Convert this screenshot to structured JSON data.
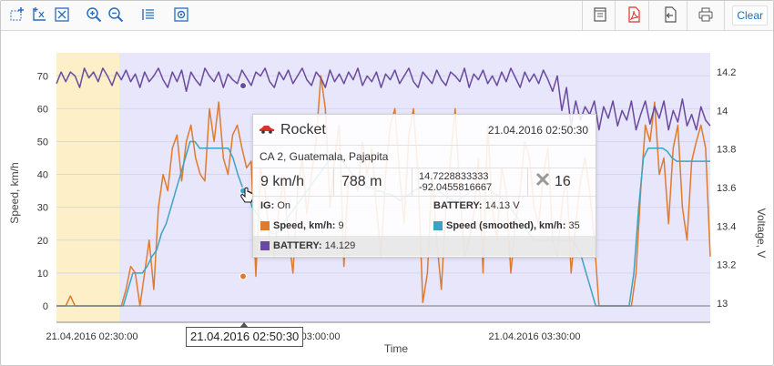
{
  "toolbar": {
    "left_icons": [
      "select-zoom-icon",
      "zoom-x-icon",
      "zoom-fit-icon",
      "zoom-in-icon",
      "zoom-out-icon",
      "legend-list-icon",
      "snapshot-icon"
    ],
    "right_icons": [
      "document-icon",
      "pdf-icon",
      "export-icon",
      "print-icon"
    ],
    "clear_label": "Clear"
  },
  "chart_data": {
    "type": "line",
    "xlabel": "Time",
    "ylabel": "Speed, km/h",
    "y2label": "Voltage, V",
    "ylim": [
      -5,
      77
    ],
    "y2lim": [
      12.9,
      14.3
    ],
    "y_ticks": [
      "0",
      "10",
      "20",
      "30",
      "40",
      "50",
      "60",
      "70"
    ],
    "y2_ticks": [
      "13",
      "13.2",
      "13.4",
      "13.6",
      "13.8",
      "14",
      "14.2"
    ],
    "x_ticks": [
      "21.04.2016 02:30:00",
      "21.04.2016 03:00:00",
      "21.04.2016 03:30:00"
    ],
    "highlight_x_label": "21.04.2016 02:50:30",
    "series": [
      {
        "name": "Speed, km/h",
        "color": "#e07b2e",
        "axis": "left",
        "values": [
          0,
          0,
          0,
          3,
          0,
          0,
          0,
          0,
          0,
          0,
          0,
          0,
          0,
          0,
          0,
          5,
          12,
          10,
          0,
          10,
          20,
          5,
          30,
          40,
          35,
          48,
          52,
          38,
          50,
          55,
          45,
          40,
          38,
          60,
          50,
          62,
          45,
          40,
          52,
          55,
          48,
          42,
          44,
          9,
          42,
          35,
          20,
          15,
          30,
          38,
          22,
          10,
          35,
          45,
          28,
          40,
          50,
          70,
          60,
          30,
          45,
          55,
          12,
          40,
          38,
          35,
          50,
          40,
          48,
          30,
          15,
          40,
          55,
          60,
          40,
          25,
          52,
          60,
          40,
          1,
          10,
          40,
          20,
          5,
          30,
          45,
          60,
          35,
          15,
          20,
          28,
          45,
          10,
          55,
          30,
          20,
          42,
          35,
          10,
          25,
          35,
          50,
          45,
          30,
          25,
          40,
          48,
          20,
          15,
          30,
          40,
          10,
          25,
          38,
          45,
          35,
          20,
          0,
          0,
          0,
          0,
          0,
          0,
          0,
          0,
          10,
          35,
          55,
          50,
          62,
          40,
          45,
          25,
          48,
          55,
          30,
          20,
          44,
          50,
          55,
          48,
          15
        ]
      },
      {
        "name": "Speed (smoothed), km/h",
        "color": "#3da3c4",
        "axis": "left",
        "values": [
          0,
          0,
          0,
          0,
          0,
          0,
          0,
          0,
          0,
          0,
          0,
          0,
          0,
          0,
          0,
          5,
          10,
          10,
          10,
          12,
          15,
          17,
          22,
          25,
          30,
          35,
          40,
          45,
          50,
          50,
          48,
          48,
          48,
          48,
          48,
          48,
          48,
          45,
          40,
          36,
          35,
          30,
          28,
          26,
          25,
          22,
          22,
          24,
          26,
          28,
          30,
          32,
          34,
          36,
          38,
          40,
          42,
          44,
          46,
          45,
          44,
          42,
          40,
          38,
          38,
          36,
          36,
          35,
          35,
          34,
          34,
          33,
          32,
          33,
          34,
          35,
          36,
          37,
          37,
          36,
          35,
          34,
          33,
          32,
          32,
          33,
          34,
          35,
          36,
          36,
          36,
          35,
          34,
          33,
          32,
          30,
          28,
          26,
          24,
          22,
          20,
          20,
          20,
          20,
          20,
          20,
          20,
          20,
          20,
          18,
          15,
          10,
          5,
          0,
          0,
          0,
          0,
          0,
          0,
          0,
          0,
          10,
          30,
          45,
          48,
          48,
          48,
          48,
          47,
          45,
          44,
          44,
          44,
          44,
          44,
          44,
          44,
          44
        ]
      },
      {
        "name": "BATTERY",
        "color": "#6a4a9c",
        "axis": "right",
        "values": [
          14.14,
          14.2,
          14.15,
          14.2,
          14.18,
          14.12,
          14.22,
          14.17,
          14.2,
          14.15,
          14.22,
          14.18,
          14.13,
          14.2,
          14.16,
          14.21,
          14.15,
          14.19,
          14.12,
          14.2,
          14.15,
          14.18,
          14.22,
          14.16,
          14.12,
          14.2,
          14.15,
          14.21,
          14.1,
          14.2,
          14.16,
          14.13,
          14.22,
          14.18,
          14.15,
          14.2,
          14.12,
          14.19,
          14.16,
          14.14,
          14.21,
          14.17,
          14.13,
          14.2,
          14.18,
          14.22,
          14.15,
          14.12,
          14.2,
          14.16,
          14.21,
          14.14,
          14.18,
          14.22,
          14.16,
          14.13,
          14.2,
          14.17,
          14.12,
          14.21,
          14.15,
          14.19,
          14.14,
          14.2,
          14.16,
          14.22,
          14.13,
          14.18,
          14.15,
          14.2,
          14.12,
          14.19,
          14.16,
          14.21,
          14.14,
          14.18,
          14.22,
          14.15,
          14.12,
          14.2,
          14.17,
          14.14,
          14.21,
          14.16,
          14.13,
          14.2,
          14.18,
          14.15,
          14.22,
          14.12,
          14.19,
          14.16,
          14.21,
          14.14,
          14.18,
          14.13,
          14.2,
          14.15,
          14.22,
          14.17,
          14.12,
          14.2,
          14.15,
          14.19,
          14.14,
          14.21,
          14.16,
          14.1,
          14.18,
          14.0,
          14.12,
          13.92,
          14.05,
          13.95,
          14.02,
          13.98,
          14.05,
          13.9,
          14.02,
          13.96,
          14.05,
          13.92,
          14.0,
          13.95,
          14.05,
          13.9,
          13.98,
          14.05,
          13.93,
          14.02,
          13.96,
          14.05,
          13.9,
          14.0,
          13.94,
          14.06,
          13.92,
          13.98,
          13.9,
          14.02,
          13.95,
          13.92
        ]
      }
    ],
    "marker_speed": {
      "label": "Speed, km/h",
      "value": 9
    },
    "marker_smoothed": {
      "value": 35
    },
    "marker_battery": {
      "value": 14.129
    }
  },
  "tooltip": {
    "vehicle_name": "Rocket",
    "datetime": "21.04.2016 02:50:30",
    "address": "CA 2, Guatemala, Pajapita",
    "speed": "9 km/h",
    "altitude": "788 m",
    "lat": "14.7228833333",
    "lon": "-92.0455816667",
    "satellites": "16",
    "ig_label": "IG:",
    "ig_value": "On",
    "battery_label": "BATTERY:",
    "battery_value": "14.13 V",
    "speed_series_label": "Speed, km/h:",
    "speed_series_value": "9",
    "smoothed_series_label": "Speed (smoothed), km/h:",
    "smoothed_series_value": "35",
    "battery_series_label": "BATTERY:",
    "battery_series_value": "14.129"
  },
  "colors": {
    "night_band": "#e8e6fb",
    "day_band": "#fdf0c8",
    "speed": "#e07b2e",
    "smoothed": "#3da3c4",
    "battery": "#6a4a9c"
  }
}
